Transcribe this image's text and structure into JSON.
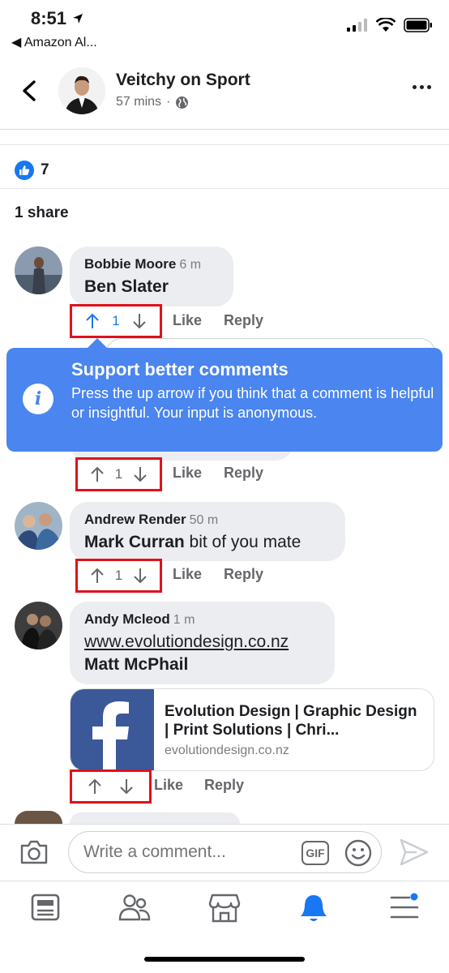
{
  "status_bar": {
    "time": "8:51",
    "back_app": "◀ Amazon Al..."
  },
  "header": {
    "page_name": "Veitchy on Sport",
    "post_time": "57 mins",
    "separator": "·"
  },
  "post": {
    "reaction_count": "7",
    "shares": "1 share"
  },
  "comments": [
    {
      "author": "Bobbie Moore",
      "time": "6 m",
      "tag": "Ben Slater",
      "text": "",
      "vote_count": "1",
      "like_label": "Like",
      "reply_label": "Reply"
    },
    {
      "vote_count": "1",
      "like_label": "Like",
      "reply_label": "Reply"
    },
    {
      "author": "Andrew Render",
      "time": "50 m",
      "tag": "Mark Curran",
      "text": " bit of you mate",
      "vote_count": "1",
      "like_label": "Like",
      "reply_label": "Reply"
    },
    {
      "author": "Andy Mcleod",
      "time": "1 m",
      "link": "www.evolutiondesign.co.nz",
      "tag": "Matt McPhail",
      "like_label": "Like",
      "reply_label": "Reply"
    }
  ],
  "tooltip": {
    "title": "Support better comments",
    "body": "Press the up arrow if you think that a comment is helpful or insightful. Your input is anonymous."
  },
  "link_preview": {
    "title": "Evolution Design | Graphic Design | Print Solutions | Chri...",
    "domain": "evolutiondesign.co.nz"
  },
  "composer": {
    "placeholder": "Write a comment...",
    "gif_label": "GIF"
  },
  "colors": {
    "accent": "#1877f2",
    "tooltip": "#4a85f0",
    "highlight_box": "#e0111b",
    "facebook_blue": "#3b5998"
  },
  "icons": [
    "back-chevron-icon",
    "more-icon",
    "globe-icon",
    "like-icon",
    "up-arrow-icon",
    "down-arrow-icon",
    "info-icon",
    "camera-icon",
    "smile-icon",
    "send-icon",
    "news-feed-icon",
    "groups-icon",
    "marketplace-icon",
    "notifications-icon",
    "menu-icon"
  ]
}
